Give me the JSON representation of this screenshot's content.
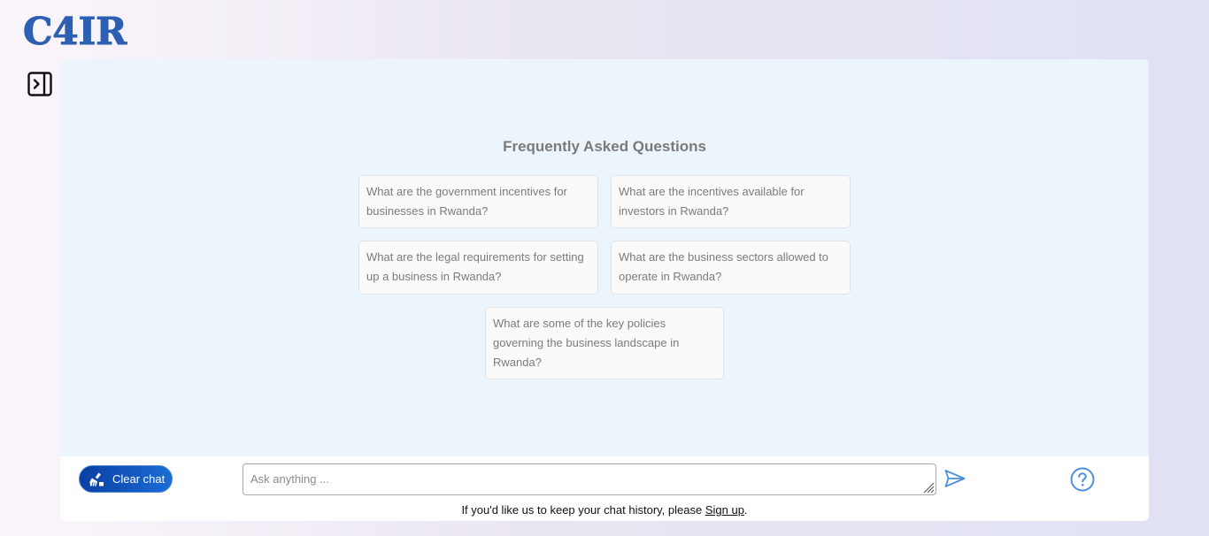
{
  "brand": {
    "logo_text": "C4IR",
    "logo_color": "#2d5fb2"
  },
  "sidebar": {
    "toggle_icon": "sidebar-expand-icon"
  },
  "faq": {
    "title": "Frequently Asked Questions",
    "questions": [
      "What are the government incentives for businesses in Rwanda?",
      "What are the incentives available for investors in Rwanda?",
      "What are the legal requirements for setting up a business in Rwanda?",
      "What are the business sectors allowed to operate in Rwanda?",
      "What are some of the key policies governing the business landscape in Rwanda?"
    ]
  },
  "composer": {
    "clear_label": "Clear chat",
    "clear_icon": "broom-icon",
    "input_placeholder": "Ask anything ...",
    "input_value": "",
    "send_icon": "send-icon",
    "help_icon": "help-icon"
  },
  "footer": {
    "note_prefix": "If you'd like us to keep your chat history, please ",
    "signup_label": "Sign up",
    "note_suffix": "."
  },
  "colors": {
    "accent": "#1a6dd6",
    "chat_bg": "#edf5fc",
    "icon_blue": "#4d8fd9"
  }
}
